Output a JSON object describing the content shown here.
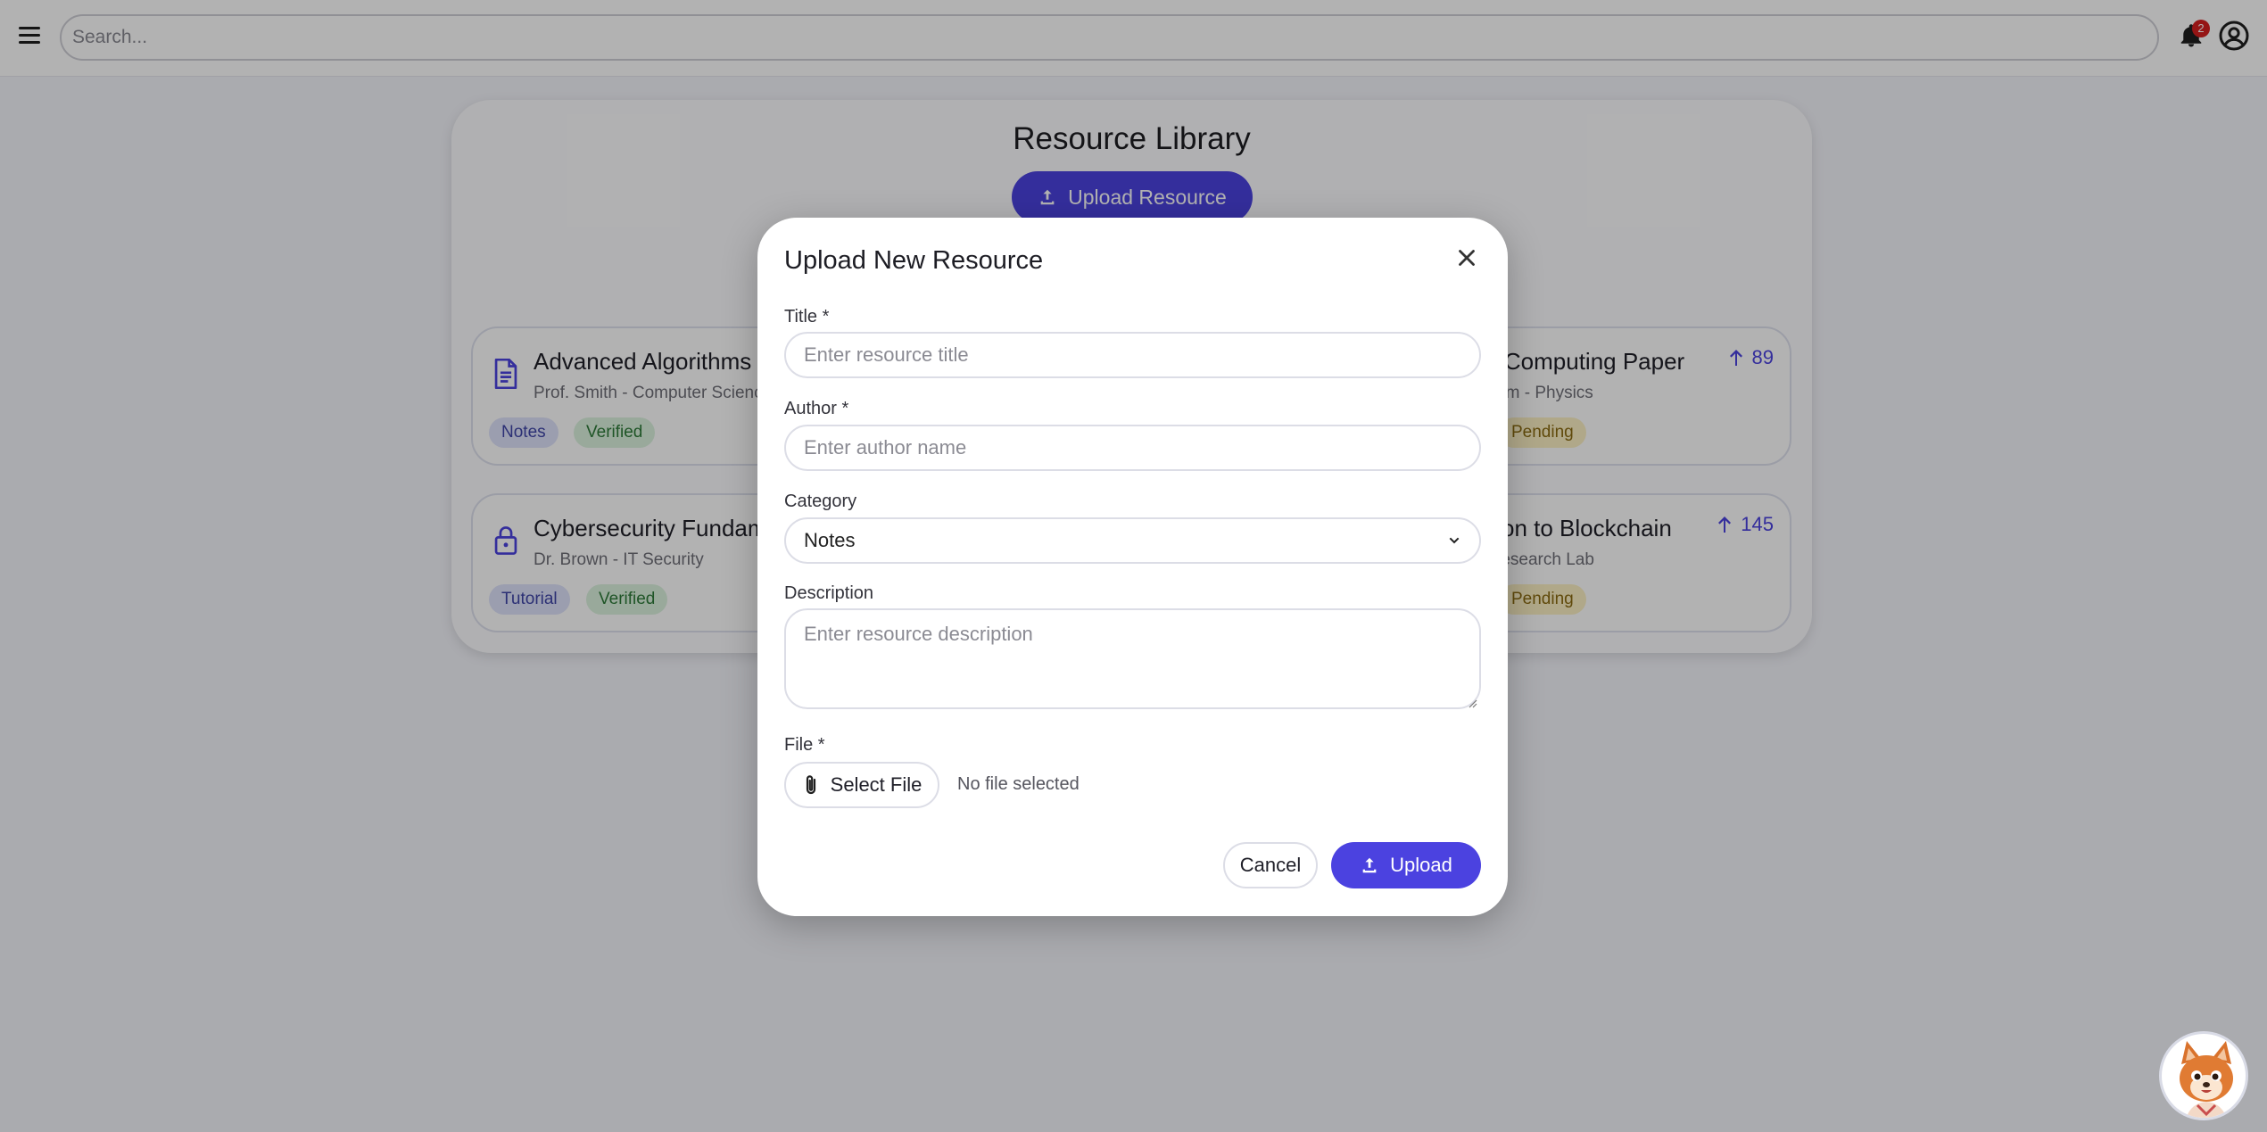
{
  "topbar": {
    "search_placeholder": "Search...",
    "notification_count": "2"
  },
  "library": {
    "title": "Resource Library",
    "upload_button": "Upload Resource",
    "cards": [
      {
        "title_left": "Advanced Algorithms No",
        "subtitle_left": "Prof. Smith - Computer Science",
        "title_right": "m Computing Paper",
        "subtitle_right": "Team - Physics",
        "votes": "89",
        "tags": [
          "Notes",
          "Verified",
          "Pending"
        ],
        "icon": "document-icon"
      },
      {
        "title_left": "Cybersecurity Fundamen",
        "subtitle_left": "Dr. Brown - IT Security",
        "title_right": "ction to Blockchain",
        "subtitle_right": "- Research Lab",
        "votes": "145",
        "tags": [
          "Tutorial",
          "Verified",
          "Pending"
        ],
        "icon": "lock-icon"
      }
    ]
  },
  "modal": {
    "title": "Upload New Resource",
    "title_label": "Title *",
    "title_placeholder": "Enter resource title",
    "author_label": "Author *",
    "author_placeholder": "Enter author name",
    "category_label": "Category",
    "category_value": "Notes",
    "description_label": "Description",
    "description_placeholder": "Enter resource description",
    "file_label": "File *",
    "select_file": "Select File",
    "file_status": "No file selected",
    "cancel": "Cancel",
    "upload": "Upload"
  },
  "colors": {
    "accent": "#4b42e0",
    "badge": "#d61f1f"
  }
}
